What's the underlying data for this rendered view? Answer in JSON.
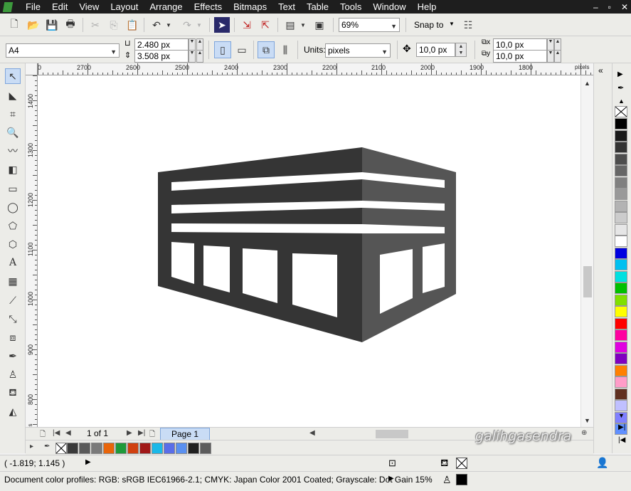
{
  "menu": [
    "File",
    "Edit",
    "View",
    "Layout",
    "Arrange",
    "Effects",
    "Bitmaps",
    "Text",
    "Table",
    "Tools",
    "Window",
    "Help"
  ],
  "window_controls": [
    "–",
    "▫",
    "✕"
  ],
  "standard_toolbar": {
    "zoom_value": "69%",
    "snap_label": "Snap to"
  },
  "property_bar": {
    "page_size": "A4",
    "width": "2.480 px",
    "height": "3.508 px",
    "units_label": "Units:",
    "units_value": "pixels",
    "nudge": "10,0 px",
    "dup_x": "10,0 px",
    "dup_y": "10,0 px"
  },
  "hruler": {
    "labels": [
      "0",
      "2700",
      "2600",
      "2500",
      "2400",
      "2300",
      "2200",
      "2100",
      "2000",
      "1900",
      "1800"
    ],
    "unit": "pixels"
  },
  "vruler": {
    "labels": [
      "1400",
      "1300",
      "1200",
      "1100",
      "1000",
      "900",
      "800"
    ],
    "unit": "pixels"
  },
  "page_nav": {
    "count": "1 of 1",
    "tab": "Page 1"
  },
  "status": {
    "coords": "( -1.819; 1.145 )",
    "profiles": "Document color profiles: RGB: sRGB IEC61966-2.1; CMYK: Japan Color 2001 Coated; Grayscale: Dot Gain 15%"
  },
  "watermark": "galihgasendra",
  "colors": {
    "front_face": "#353535",
    "side_face": "#555555",
    "accent": "#c9dcf5"
  },
  "bottom_palette": [
    "#3a3a3a",
    "#5a5a5a",
    "#7a7a7a",
    "#e8650a",
    "#1e9a3a",
    "#d04010",
    "#a01818",
    "#1ab8e8",
    "#5a6ee8",
    "#5a90f0",
    "#202020",
    "#5c5c5c"
  ],
  "right_palette": [
    "#000000",
    "#1a1a1a",
    "#333333",
    "#4d4d4d",
    "#666666",
    "#808080",
    "#999999",
    "#b3b3b3",
    "#cccccc",
    "#e6e6e6",
    "#ffffff",
    "#0000e0",
    "#00c0f0",
    "#00e0e0",
    "#00c000",
    "#80e000",
    "#ffff00",
    "#ff0000",
    "#ff00a0",
    "#e000e0",
    "#8000c0",
    "#ff8000",
    "#ff9cc8",
    "#603020",
    "#c0c0ff",
    "#8080ff",
    "#6090ff"
  ]
}
